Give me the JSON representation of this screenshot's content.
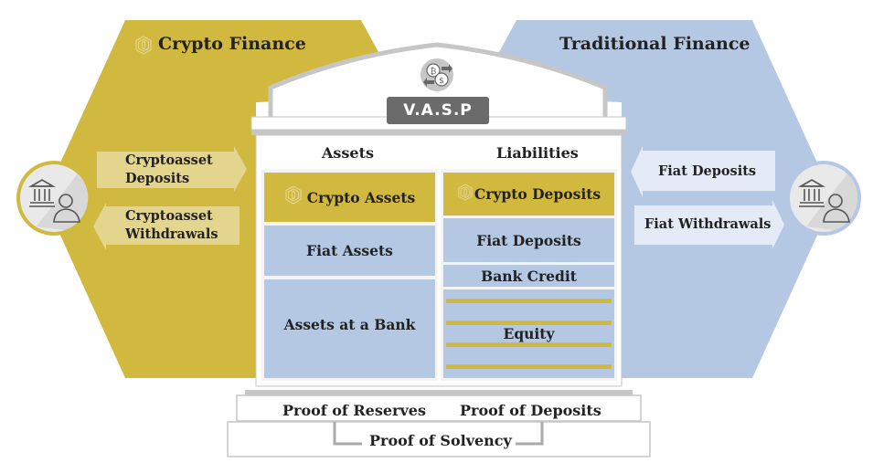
{
  "colors": {
    "crypto_gold": "#d1b83e",
    "crypto_light": "#e3d48e",
    "fiat_blue": "#b4c8e3",
    "fiat_light": "#e4ebf6",
    "building_gray": "#c6c6c6",
    "vasp_badge": "#6b6b6b"
  },
  "left_panel": {
    "title": "Crypto Finance",
    "title_icon": "crypto-coin-icon",
    "user_icon": "bank-customer-icon",
    "arrows": [
      {
        "label": "Cryptoasset Deposits",
        "line1": "Cryptoasset",
        "line2": "Deposits",
        "direction": "right"
      },
      {
        "label": "Cryptoasset Withdrawals",
        "line1": "Cryptoasset",
        "line2": "Withdrawals",
        "direction": "left"
      }
    ]
  },
  "right_panel": {
    "title": "Traditional Finance",
    "user_icon": "bank-customer-icon",
    "arrows": [
      {
        "label": "Fiat Deposits",
        "direction": "left"
      },
      {
        "label": "Fiat Withdrawals",
        "direction": "right"
      }
    ]
  },
  "building": {
    "roof_icon": "crypto-fiat-exchange-icon",
    "badge": "V.A.S.P",
    "assets": {
      "header": "Assets",
      "items": [
        {
          "label": "Crypto Assets",
          "type": "crypto",
          "icon": "crypto-coin-icon"
        },
        {
          "label": "Fiat Assets",
          "type": "fiat"
        },
        {
          "label": "Assets at a Bank",
          "type": "fiat"
        }
      ]
    },
    "liabilities": {
      "header": "Liabilities",
      "items": [
        {
          "label": "Crypto Deposits",
          "type": "crypto",
          "icon": "crypto-coin-icon"
        },
        {
          "label": "Fiat Deposits",
          "type": "fiat"
        },
        {
          "label": "Bank Credit",
          "type": "fiat"
        },
        {
          "label": "Equity",
          "type": "mixed"
        }
      ]
    }
  },
  "foundation": {
    "proof_left": "Proof of Reserves",
    "proof_right": "Proof of Deposits",
    "proof_bottom": "Proof of Solvency"
  }
}
